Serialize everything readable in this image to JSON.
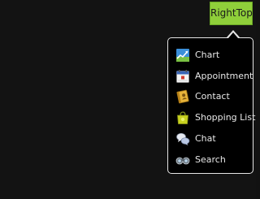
{
  "trigger": {
    "label": "RightTop",
    "color": "#8fcf3a"
  },
  "menu": {
    "items": [
      {
        "label": "Chart",
        "icon": "chart-icon"
      },
      {
        "label": "Appointment",
        "icon": "calendar-icon"
      },
      {
        "label": "Contact",
        "icon": "contact-book-icon"
      },
      {
        "label": "Shopping List",
        "icon": "shopping-bag-icon"
      },
      {
        "label": "Chat",
        "icon": "chat-bubbles-icon"
      },
      {
        "label": "Search",
        "icon": "binoculars-icon"
      }
    ]
  }
}
